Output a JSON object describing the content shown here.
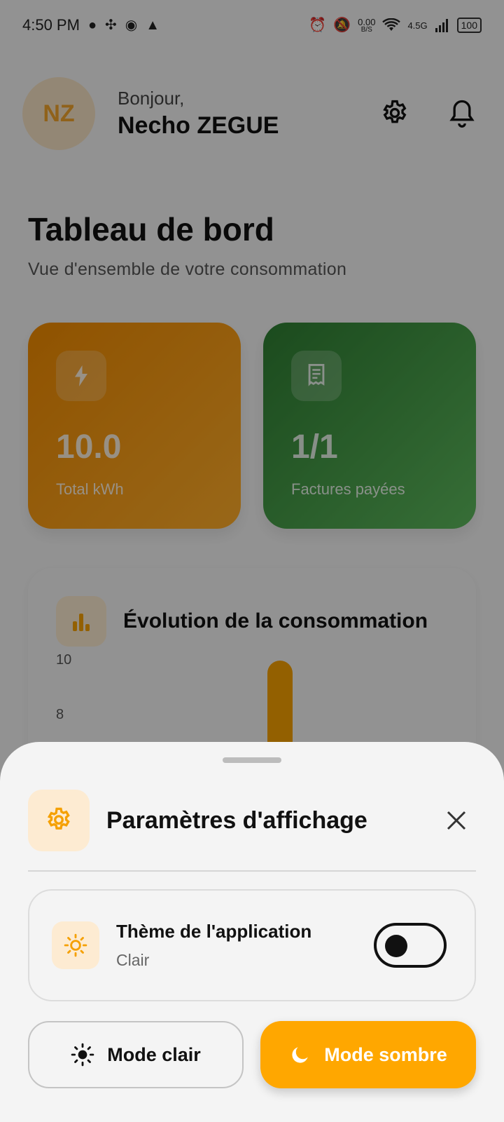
{
  "status_bar": {
    "time": "4:50 PM",
    "net_speed_value": "0.00",
    "net_speed_unit": "B/S",
    "network": "4.5G",
    "battery": "100"
  },
  "header": {
    "avatar_initials": "NZ",
    "greeting": "Bonjour,",
    "user_name": "Necho ZEGUE"
  },
  "dashboard": {
    "title": "Tableau de bord",
    "subtitle": "Vue d'ensemble de votre consommation",
    "cards": [
      {
        "value": "10.0",
        "label": "Total kWh",
        "icon": "bolt-icon",
        "color": "#f39200"
      },
      {
        "value": "1/1",
        "label": "Factures payées",
        "icon": "receipt-icon",
        "color": "#3a8a3e"
      }
    ]
  },
  "chart_card": {
    "title": "Évolution de la consommation",
    "ticks": [
      "10",
      "8"
    ]
  },
  "chart_data": {
    "type": "bar",
    "y_ticks": [
      8,
      10
    ],
    "visible_bar_value": 10,
    "bar_color": "#f5a000"
  },
  "sheet": {
    "title": "Paramètres d'affichage",
    "theme_label": "Thème de l'application",
    "theme_value": "Clair",
    "toggle_on": false,
    "light_mode_label": "Mode clair",
    "dark_mode_label": "Mode sombre",
    "accent_color": "#ffa700"
  }
}
